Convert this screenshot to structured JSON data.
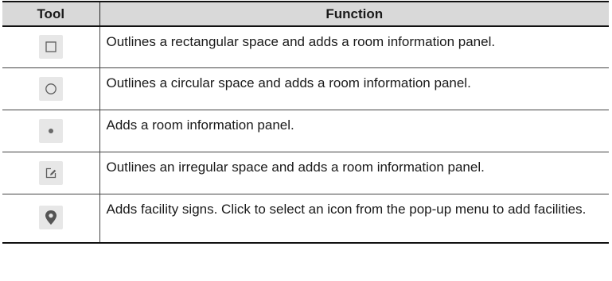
{
  "table": {
    "headers": {
      "tool": "Tool",
      "function": "Function"
    },
    "rows": [
      {
        "icon": "square-icon",
        "function": "Outlines a rectangular space and adds a room information panel."
      },
      {
        "icon": "circle-icon",
        "function": "Outlines a circular space and adds a room information panel."
      },
      {
        "icon": "dot-icon",
        "function": "Adds a room information panel."
      },
      {
        "icon": "edit-icon",
        "function": "Outlines an irregular space and adds a room information panel."
      },
      {
        "icon": "location-pin-icon",
        "function": "Adds facility signs. Click to select an icon from the pop-up menu to add facilities."
      }
    ]
  },
  "colors": {
    "header_bg": "#d9d9d9",
    "icon_bg": "#e7e7e7",
    "icon_stroke": "#5f5f5f"
  }
}
